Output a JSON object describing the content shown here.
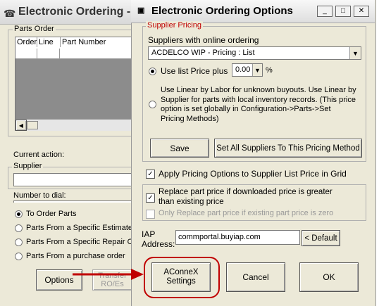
{
  "background_window": {
    "title": "Electronic Ordering - R",
    "parts_order_label": "Parts Order",
    "columns": [
      "Order",
      "Line",
      "Part Number"
    ],
    "current_action_label": "Current action:",
    "supplier_label": "Supplier",
    "number_to_dial_label": "Number to dial:",
    "radio_options": [
      {
        "label": "To Order Parts",
        "selected": true
      },
      {
        "label": "Parts From a Specific Estimate",
        "selected": false
      },
      {
        "label": "Parts From a Specific Repair Or",
        "selected": false
      },
      {
        "label": "Parts From a purchase order",
        "selected": false
      }
    ],
    "options_button": "Options",
    "transfer_button_line1": "Transfer",
    "transfer_button_line2": "RO/Es"
  },
  "dialog": {
    "title": "Electronic Ordering Options",
    "title_buttons": {
      "minimize": "_",
      "maximize": "□",
      "close": "✕"
    },
    "supplier_pricing_label": "Supplier Pricing",
    "suppliers_label": "Suppliers with online ordering",
    "supplier_selected": "ACDELCO WIP - Pricing : List",
    "use_list_price_label": "Use list Price plus",
    "list_price_value": "0.00",
    "percent_symbol": "%",
    "use_list_selected": true,
    "linear_option_text": "Use Linear by Labor for unknown buyouts. Use Linear by Supplier for parts with local inventory records.  (This price option is set globally in Configuration->Parts->Set Pricing Methods)",
    "linear_selected": false,
    "save_button": "Save",
    "set_all_button": "Set All Suppliers To This Pricing Method",
    "apply_pricing_label": "Apply Pricing Options to Supplier List Price in Grid",
    "apply_pricing_checked": true,
    "replace_price_label_line1": "Replace part price if downloaded price is greater",
    "replace_price_label_line2": "than existing price",
    "replace_price_checked": true,
    "only_replace_label": "Only Replace part price if existing part price is zero",
    "only_replace_checked": false,
    "iap_label_line1": "IAP",
    "iap_label_line2": "Address:",
    "iap_address": "commportal.buyiap.com",
    "default_button": "< Default",
    "aconnex_line1": "AConneX",
    "aconnex_line2": "Settings",
    "cancel_button": "Cancel",
    "ok_button": "OK"
  },
  "colors": {
    "highlight_red": "#c00000",
    "supplier_pricing_label": "#c00000"
  }
}
